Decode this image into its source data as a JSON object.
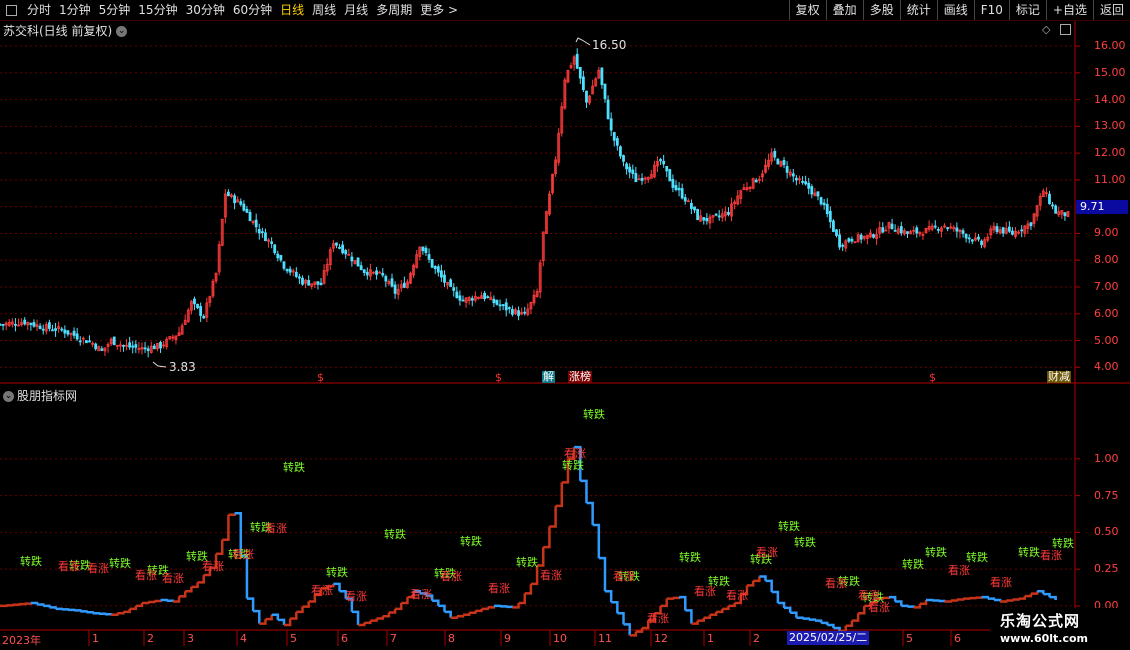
{
  "toolbar": {
    "periods": [
      "分时",
      "1分钟",
      "5分钟",
      "15分钟",
      "30分钟",
      "60分钟",
      "日线",
      "周线",
      "月线",
      "多周期",
      "更多 >"
    ],
    "active_period": "日线",
    "right_buttons": [
      "复权",
      "叠加",
      "多股",
      "统计",
      "画线",
      "F10",
      "标记",
      "+自选",
      "返回"
    ]
  },
  "price_panel": {
    "title": "苏交科(日线 前复权)",
    "y_ticks": [
      "16.00",
      "15.00",
      "14.00",
      "13.00",
      "12.00",
      "11.00",
      "10.00",
      "9.00",
      "8.00",
      "7.00",
      "6.00",
      "5.00",
      "4.00"
    ],
    "high_label": "16.50",
    "low_label": "3.83",
    "current_price": "9.71",
    "markers": [
      {
        "text": "$",
        "type": "dollar"
      },
      {
        "text": "$",
        "type": "dollar"
      },
      {
        "text": "解",
        "type": "unlock"
      },
      {
        "text": "涨榜",
        "type": "rank"
      },
      {
        "text": "$",
        "type": "dollar"
      },
      {
        "text": "财减",
        "type": "finance"
      }
    ]
  },
  "indicator_panel": {
    "title": "股朋指标网",
    "y_ticks": [
      "1.00",
      "0.75",
      "0.50",
      "0.25",
      "0.00"
    ],
    "signal_down": "转跌",
    "signal_up": "看涨"
  },
  "x_axis": {
    "labels": [
      "2023年",
      "1",
      "2",
      "3",
      "4",
      "5",
      "6",
      "7",
      "8",
      "9",
      "10",
      "11",
      "12",
      "1",
      "2",
      "5",
      "6"
    ],
    "cursor_date": "2025/02/25/二"
  },
  "watermark": {
    "name": "乐淘公式网",
    "url": "www.60lt.com"
  },
  "colors": {
    "up_candle": "#ff3c3c",
    "down_candle": "#50e0ff",
    "indicator_rising": "#c8341a",
    "indicator_falling": "#2f9bff",
    "axis": "#b00000",
    "active_tab": "#ffd200"
  },
  "chart_data": [
    {
      "type": "candlestick",
      "title": "苏交科(日线 前复权)",
      "ylim": [
        3.6,
        16.6
      ],
      "y_ticks": [
        4,
        5,
        6,
        7,
        8,
        9,
        10,
        11,
        12,
        13,
        14,
        15,
        16
      ],
      "high": 16.5,
      "low": 3.83,
      "last": 9.71,
      "close_path": [
        [
          0,
          5.6
        ],
        [
          8,
          5.7
        ],
        [
          14,
          5.5
        ],
        [
          20,
          5.4
        ],
        [
          26,
          5.1
        ],
        [
          30,
          4.9
        ],
        [
          33,
          4.6
        ],
        [
          36,
          5.0
        ],
        [
          40,
          4.8
        ],
        [
          46,
          4.7
        ],
        [
          52,
          4.8
        ],
        [
          58,
          5.3
        ],
        [
          62,
          6.4
        ],
        [
          66,
          5.9
        ],
        [
          70,
          7.5
        ],
        [
          73,
          10.5
        ],
        [
          78,
          10.1
        ],
        [
          84,
          9.1
        ],
        [
          88,
          8.6
        ],
        [
          92,
          7.8
        ],
        [
          98,
          7.2
        ],
        [
          104,
          7.1
        ],
        [
          108,
          8.7
        ],
        [
          112,
          8.3
        ],
        [
          118,
          7.6
        ],
        [
          124,
          7.4
        ],
        [
          128,
          6.8
        ],
        [
          132,
          7.2
        ],
        [
          136,
          8.6
        ],
        [
          140,
          7.8
        ],
        [
          146,
          6.9
        ],
        [
          150,
          6.5
        ],
        [
          156,
          6.7
        ],
        [
          162,
          6.3
        ],
        [
          166,
          6.1
        ],
        [
          170,
          5.95
        ],
        [
          174,
          6.8
        ],
        [
          176,
          9.0
        ],
        [
          180,
          11.8
        ],
        [
          183,
          14.8
        ],
        [
          186,
          15.6
        ],
        [
          190,
          13.9
        ],
        [
          194,
          15.1
        ],
        [
          198,
          12.8
        ],
        [
          202,
          11.6
        ],
        [
          206,
          11.0
        ],
        [
          210,
          11.2
        ],
        [
          214,
          11.7
        ],
        [
          218,
          10.8
        ],
        [
          222,
          10.3
        ],
        [
          226,
          9.6
        ],
        [
          230,
          9.5
        ],
        [
          236,
          9.8
        ],
        [
          240,
          10.6
        ],
        [
          246,
          11.1
        ],
        [
          250,
          11.9
        ],
        [
          254,
          11.5
        ],
        [
          258,
          11.0
        ],
        [
          262,
          10.7
        ],
        [
          266,
          10.2
        ],
        [
          268,
          9.7
        ],
        [
          272,
          8.6
        ],
        [
          276,
          8.8
        ],
        [
          282,
          8.9
        ],
        [
          288,
          9.3
        ],
        [
          294,
          9.0
        ],
        [
          300,
          9.1
        ],
        [
          306,
          9.3
        ],
        [
          312,
          9.0
        ],
        [
          318,
          8.6
        ],
        [
          322,
          9.2
        ],
        [
          328,
          9.0
        ],
        [
          334,
          9.4
        ],
        [
          338,
          10.6
        ],
        [
          342,
          9.8
        ],
        [
          346,
          9.7
        ]
      ]
    },
    {
      "type": "line",
      "title": "股朋指标网",
      "ylim": [
        -0.15,
        1.4
      ],
      "y_ticks": [
        0,
        0.25,
        0.5,
        0.75,
        1.0
      ],
      "path": [
        [
          0,
          0.0
        ],
        [
          10,
          0.02
        ],
        [
          18,
          -0.02
        ],
        [
          24,
          -0.03
        ],
        [
          30,
          -0.05
        ],
        [
          36,
          -0.06
        ],
        [
          40,
          -0.04
        ],
        [
          46,
          0.02
        ],
        [
          52,
          0.04
        ],
        [
          56,
          0.03
        ],
        [
          60,
          0.1
        ],
        [
          64,
          0.16
        ],
        [
          68,
          0.26
        ],
        [
          72,
          0.45
        ],
        [
          74,
          0.62
        ],
        [
          76,
          0.63
        ],
        [
          80,
          0.05
        ],
        [
          84,
          -0.12
        ],
        [
          88,
          -0.06
        ],
        [
          92,
          -0.13
        ],
        [
          96,
          -0.04
        ],
        [
          100,
          0.03
        ],
        [
          104,
          0.12
        ],
        [
          108,
          0.15
        ],
        [
          112,
          0.05
        ],
        [
          116,
          -0.13
        ],
        [
          120,
          -0.1
        ],
        [
          124,
          -0.07
        ],
        [
          128,
          -0.02
        ],
        [
          134,
          0.1
        ],
        [
          138,
          0.07
        ],
        [
          142,
          0.0
        ],
        [
          146,
          -0.08
        ],
        [
          150,
          -0.06
        ],
        [
          156,
          -0.02
        ],
        [
          160,
          0.0
        ],
        [
          166,
          -0.01
        ],
        [
          168,
          0.02
        ],
        [
          172,
          0.15
        ],
        [
          176,
          0.4
        ],
        [
          180,
          0.68
        ],
        [
          184,
          1.0
        ],
        [
          186,
          1.08
        ],
        [
          188,
          0.85
        ],
        [
          192,
          0.55
        ],
        [
          196,
          0.1
        ],
        [
          200,
          -0.05
        ],
        [
          204,
          -0.2
        ],
        [
          208,
          -0.15
        ],
        [
          212,
          -0.05
        ],
        [
          216,
          0.05
        ],
        [
          220,
          0.06
        ],
        [
          224,
          -0.12
        ],
        [
          228,
          -0.08
        ],
        [
          232,
          -0.04
        ],
        [
          238,
          0.02
        ],
        [
          242,
          0.14
        ],
        [
          246,
          0.2
        ],
        [
          248,
          0.17
        ],
        [
          252,
          0.02
        ],
        [
          258,
          -0.08
        ],
        [
          264,
          -0.1
        ],
        [
          268,
          -0.13
        ],
        [
          272,
          -0.17
        ],
        [
          276,
          -0.1
        ],
        [
          280,
          0.0
        ],
        [
          284,
          0.05
        ],
        [
          288,
          0.06
        ],
        [
          292,
          0.0
        ],
        [
          296,
          -0.01
        ],
        [
          300,
          0.04
        ],
        [
          306,
          0.03
        ],
        [
          312,
          0.05
        ],
        [
          318,
          0.06
        ],
        [
          324,
          0.03
        ],
        [
          330,
          0.05
        ],
        [
          336,
          0.1
        ],
        [
          342,
          0.04
        ]
      ]
    }
  ]
}
